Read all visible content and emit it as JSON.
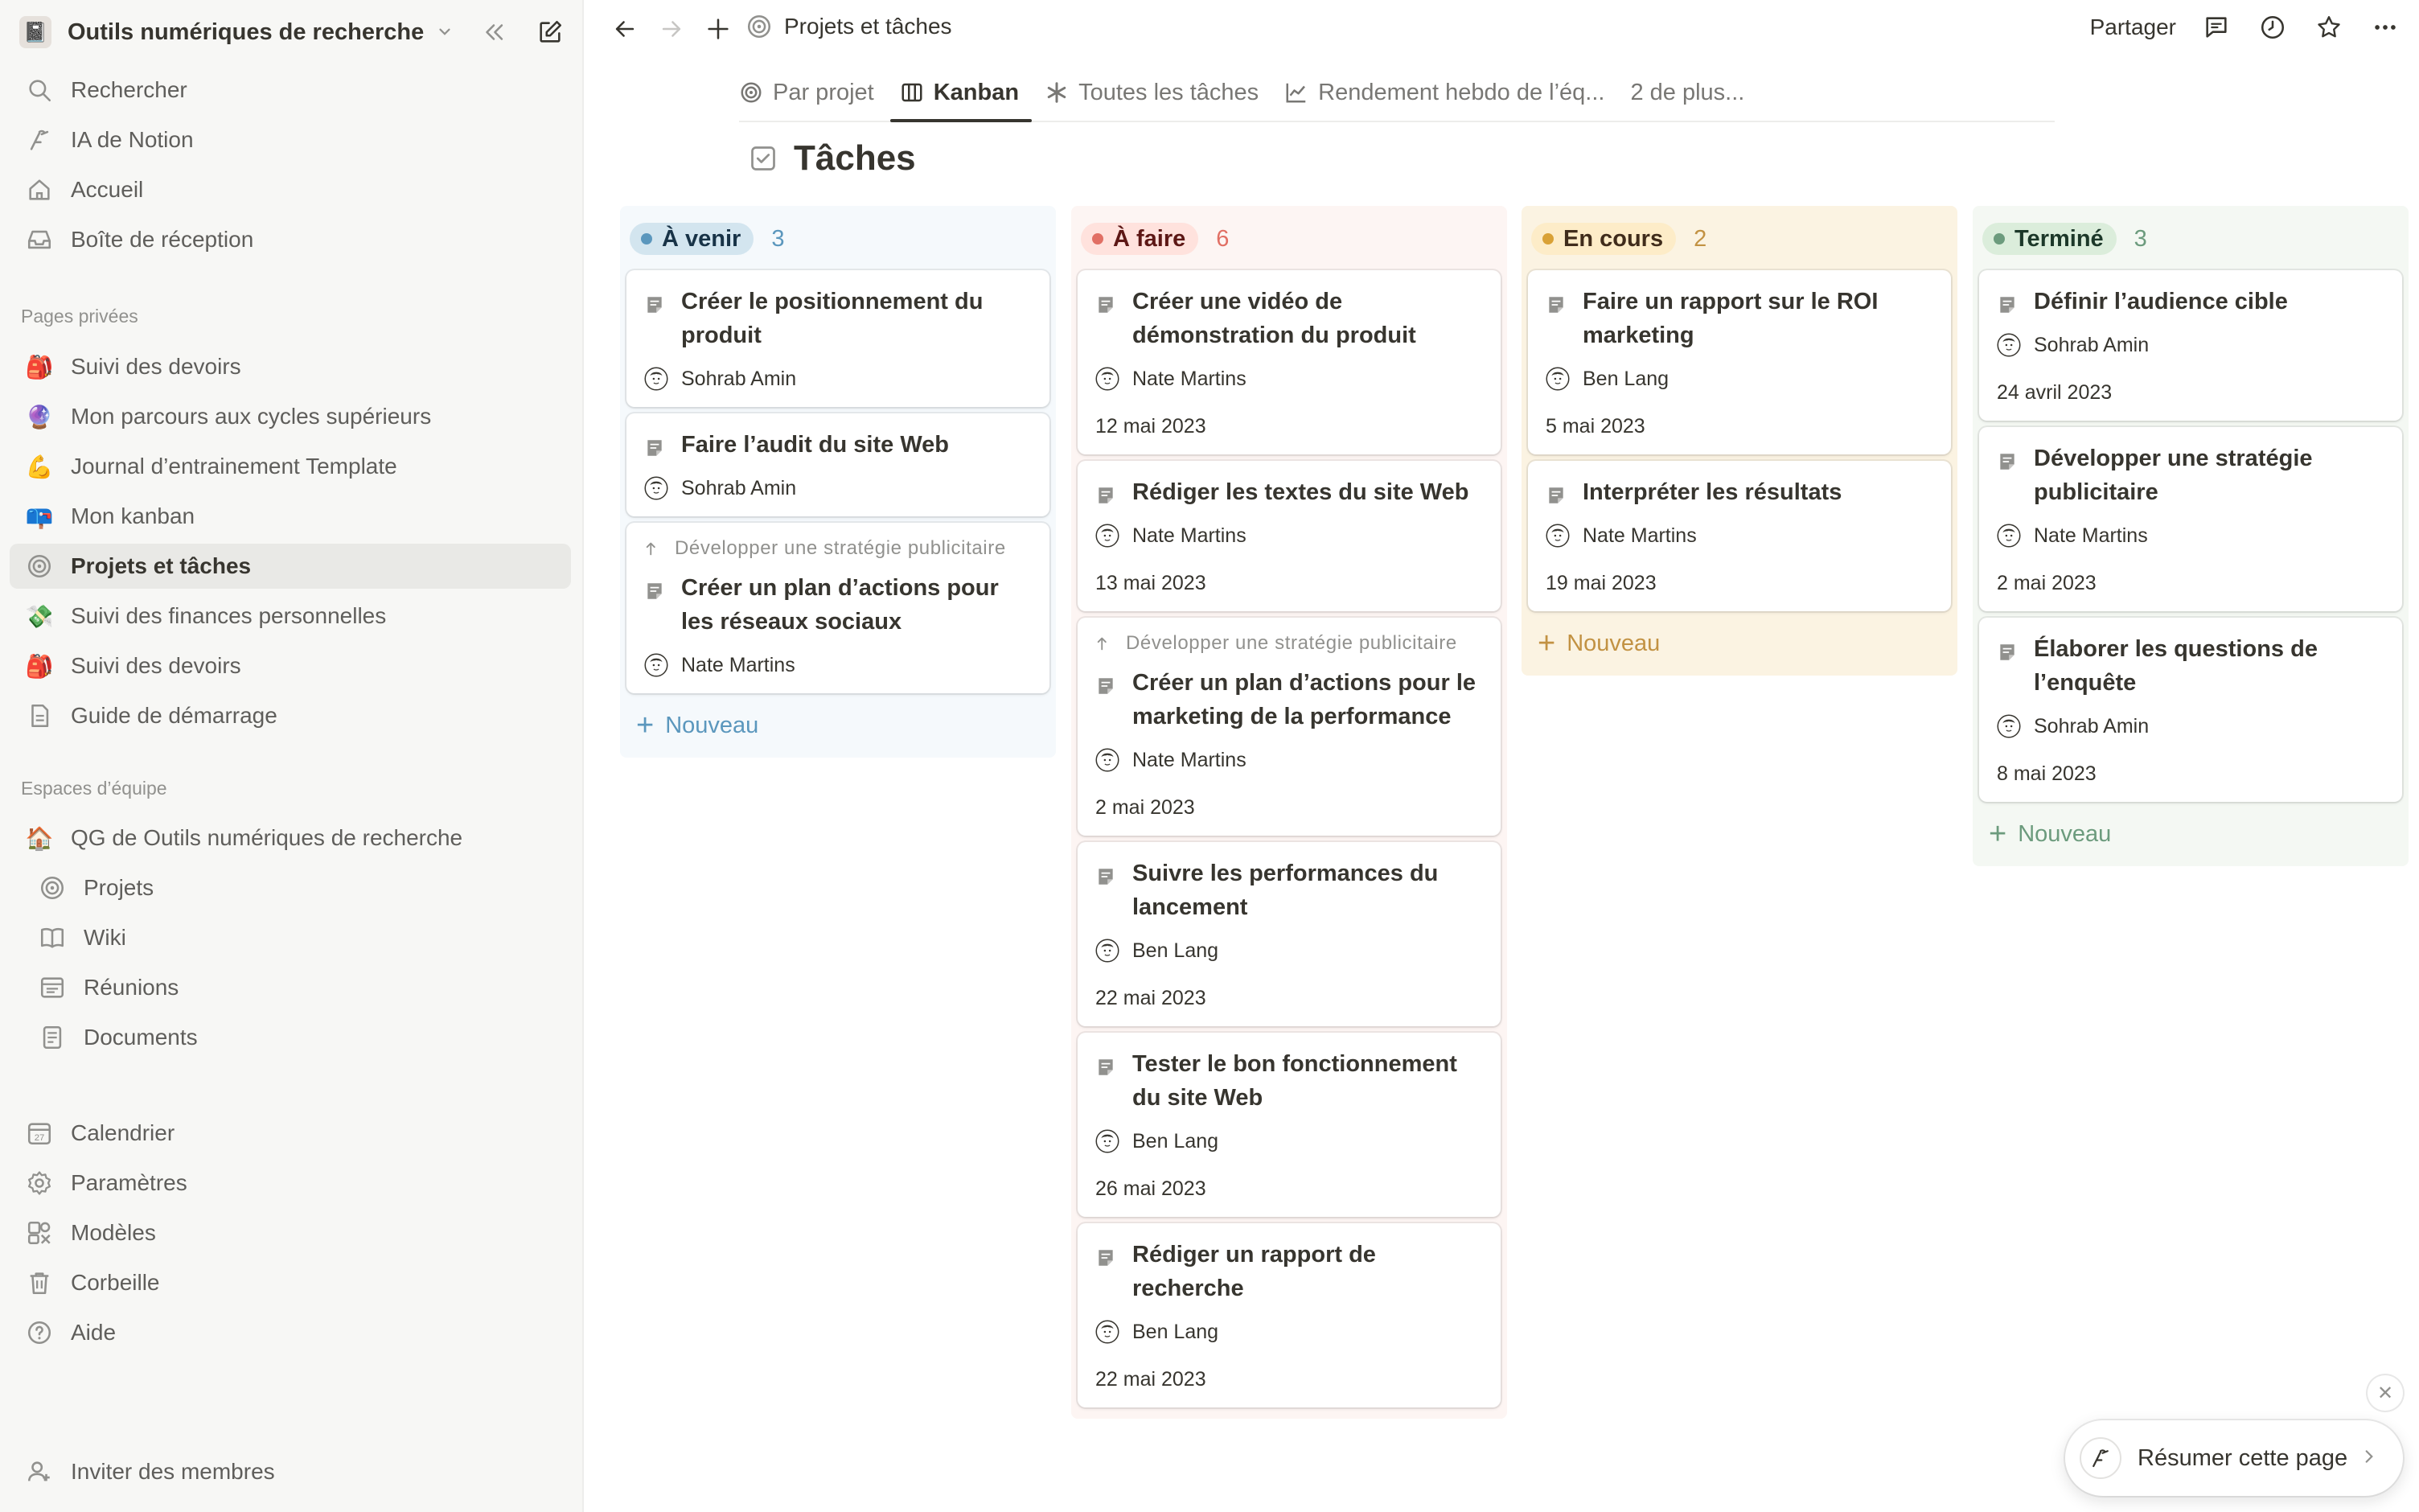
{
  "workspace": {
    "name": "Outils numériques de recherche"
  },
  "sidebar": {
    "top_items": [
      {
        "label": "Rechercher",
        "icon": "search-icon"
      },
      {
        "label": "IA de Notion",
        "icon": "notion-ai-icon"
      },
      {
        "label": "Accueil",
        "icon": "home-icon"
      },
      {
        "label": "Boîte de réception",
        "icon": "inbox-icon"
      }
    ],
    "private_label": "Pages privées",
    "private_items": [
      {
        "label": "Suivi des devoirs",
        "icon": "🎒"
      },
      {
        "label": "Mon parcours aux cycles supérieurs",
        "icon": "🔮"
      },
      {
        "label": "Journal d’entrainement Template",
        "icon": "💪"
      },
      {
        "label": "Mon kanban",
        "icon": "📪"
      },
      {
        "label": "Projets et tâches",
        "icon": "target-icon"
      },
      {
        "label": "Suivi des finances personnelles",
        "icon": "💸"
      },
      {
        "label": "Suivi des devoirs",
        "icon": "🎒"
      },
      {
        "label": "Guide de démarrage",
        "icon": "page-icon"
      }
    ],
    "team_label": "Espaces d’équipe",
    "team_items": [
      {
        "label": "QG de Outils numériques de recherche",
        "icon": "🏠"
      },
      {
        "label": "Projets",
        "icon": "target-icon"
      },
      {
        "label": "Wiki",
        "icon": "book-icon"
      },
      {
        "label": "Réunions",
        "icon": "meetings-icon"
      },
      {
        "label": "Documents",
        "icon": "document-icon"
      }
    ],
    "bottom_items": [
      {
        "label": "Calendrier",
        "icon": "calendar-icon"
      },
      {
        "label": "Paramètres",
        "icon": "gear-icon"
      },
      {
        "label": "Modèles",
        "icon": "templates-icon"
      },
      {
        "label": "Corbeille",
        "icon": "trash-icon"
      },
      {
        "label": "Aide",
        "icon": "help-icon"
      }
    ],
    "invite_label": "Inviter des membres"
  },
  "topbar": {
    "breadcrumb": "Projets et tâches",
    "share_label": "Partager"
  },
  "tabs": [
    {
      "label": "Par projet"
    },
    {
      "label": "Kanban"
    },
    {
      "label": "Toutes les tâches"
    },
    {
      "label": "Rendement hebdo de l’éq..."
    },
    {
      "label": "2 de plus..."
    }
  ],
  "page": {
    "title": "Tâches"
  },
  "board": {
    "new_label": "Nouveau",
    "columns": [
      {
        "status": "À venir",
        "count": "3",
        "bg": "#f5f9fc",
        "pill_bg": "#d3e5ef",
        "dot": "#5b97bd",
        "text": "#183347",
        "count_color": "#5b97bd",
        "cards": [
          {
            "title": "Créer le positionnement du produit",
            "person": "Sohrab Amin"
          },
          {
            "title": "Faire l’audit du site Web",
            "person": "Sohrab Amin"
          },
          {
            "parent": "Développer une stratégie publicitaire",
            "title": "Créer un plan d’actions pour les réseaux sociaux",
            "person": "Nate Martins"
          }
        ]
      },
      {
        "status": "À faire",
        "count": "6",
        "bg": "#fdf5f3",
        "pill_bg": "#ffe2dd",
        "dot": "#e16f64",
        "text": "#5d1715",
        "count_color": "#e16f64",
        "cards": [
          {
            "title": "Créer une vidéo de démonstration du produit",
            "person": "Nate Martins",
            "date": "12 mai 2023"
          },
          {
            "title": "Rédiger les textes du site Web",
            "person": "Nate Martins",
            "date": "13 mai 2023"
          },
          {
            "parent": "Développer une stratégie publicitaire",
            "title": "Créer un plan d’actions pour le marketing de la performance",
            "person": "Nate Martins",
            "date": "2 mai 2023"
          },
          {
            "title": "Suivre les performances du lancement",
            "person": "Ben Lang",
            "date": "22 mai 2023"
          },
          {
            "title": "Tester le bon fonctionnement du site Web",
            "person": "Ben Lang",
            "date": "26 mai 2023"
          },
          {
            "title": "Rédiger un rapport de recherche",
            "person": "Ben Lang",
            "date": "22 mai 2023"
          }
        ]
      },
      {
        "status": "En cours",
        "count": "2",
        "bg": "#fbf3e2",
        "pill_bg": "#fdecc8",
        "dot": "#d9a136",
        "text": "#402c1b",
        "count_color": "#c29243",
        "cards": [
          {
            "title": "Faire un rapport sur le ROI marketing",
            "person": "Ben Lang",
            "date": "5 mai 2023"
          },
          {
            "title": "Interpréter les résultats",
            "person": "Nate Martins",
            "date": "19 mai 2023"
          }
        ]
      },
      {
        "status": "Terminé",
        "count": "3",
        "bg": "#f4f8f3",
        "pill_bg": "#dbeddb",
        "dot": "#6c9b7d",
        "text": "#1c3829",
        "count_color": "#6c9b7d",
        "cards": [
          {
            "title": "Définir l’audience cible",
            "person": "Sohrab Amin",
            "date": "24 avril 2023"
          },
          {
            "title": "Développer une stratégie publicitaire",
            "person": "Nate Martins",
            "date": "2 mai 2023"
          },
          {
            "title": "Élaborer les questions de l’enquête",
            "person": "Sohrab Amin",
            "date": "8 mai 2023"
          }
        ]
      }
    ]
  },
  "resume": {
    "label": "Résumer cette page"
  }
}
